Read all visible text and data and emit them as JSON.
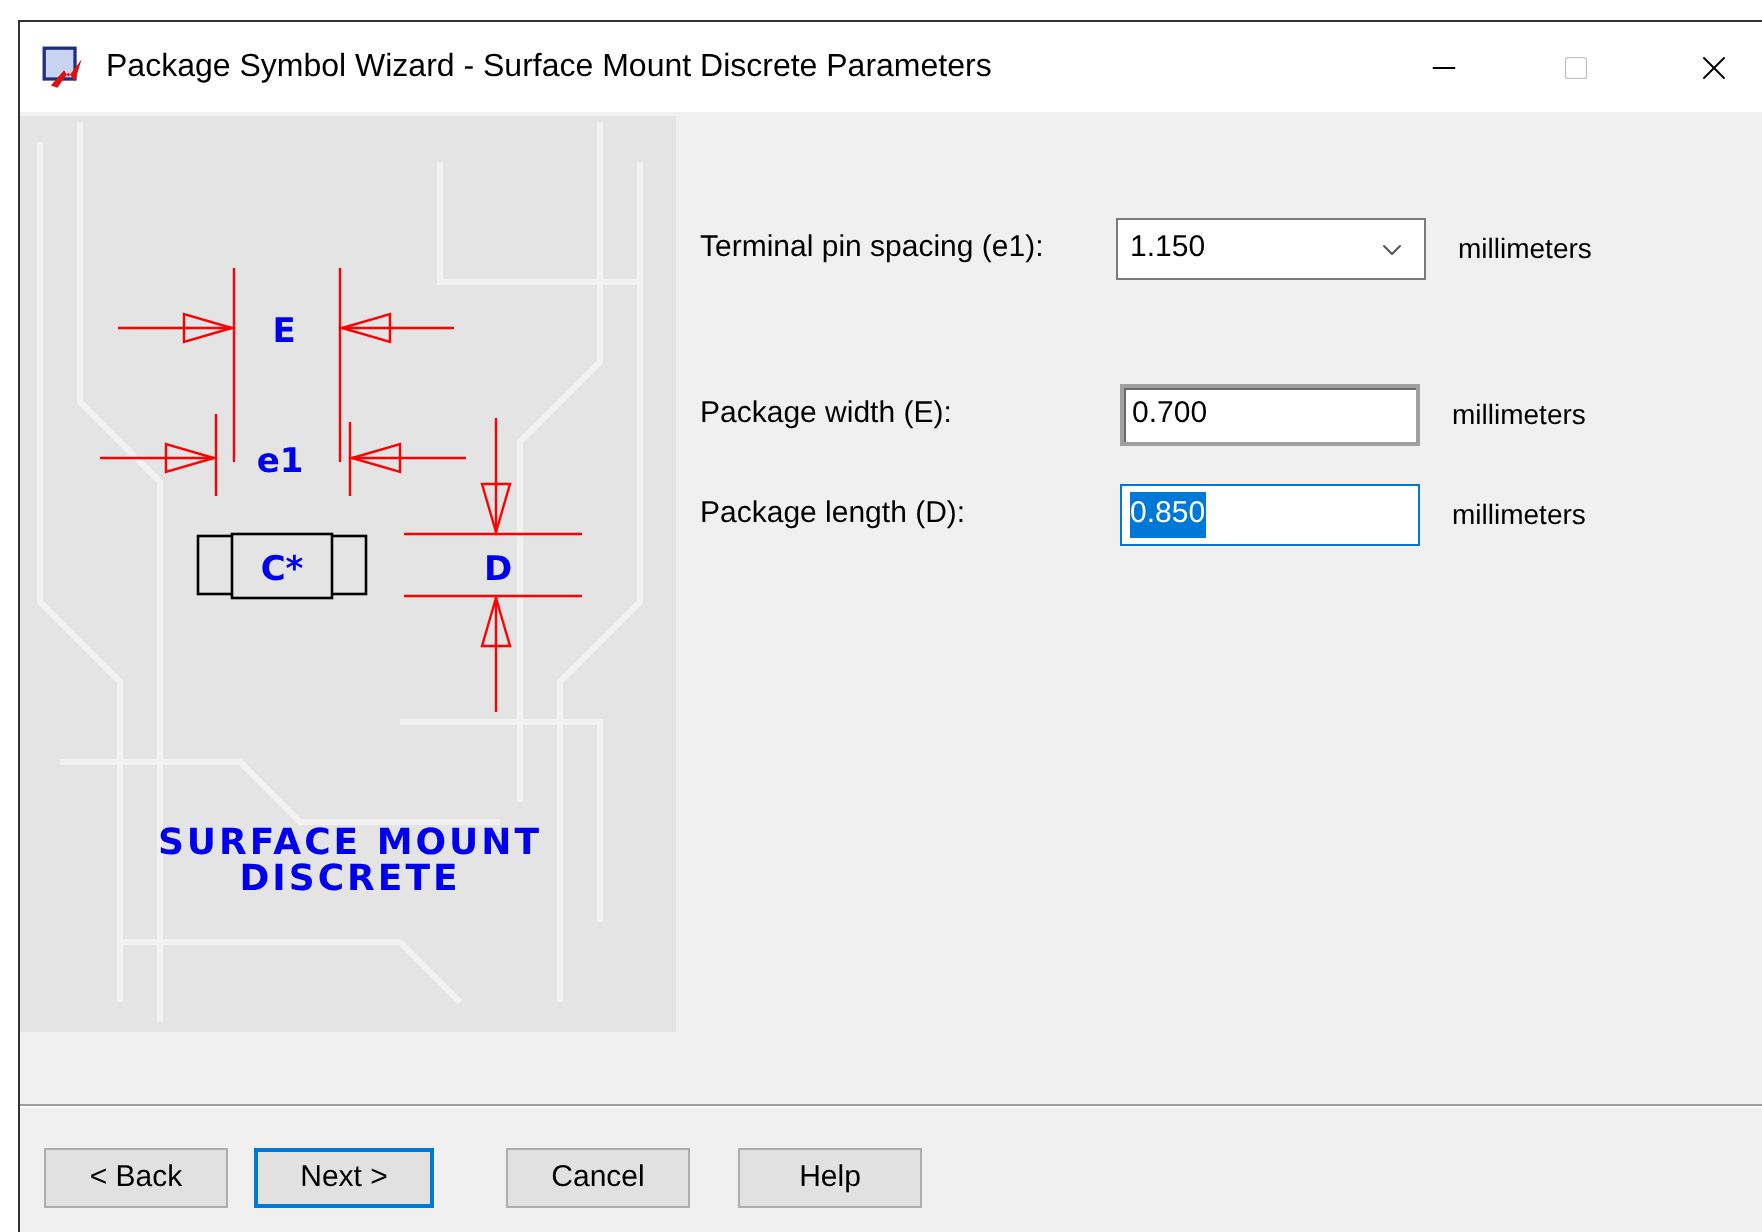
{
  "window": {
    "title": "Package Symbol Wizard - Surface Mount Discrete Parameters"
  },
  "illustration": {
    "width_label": "E",
    "pitch_label": "e1",
    "body_label": "C*",
    "length_label": "D",
    "caption": [
      "SURFACE MOUNT",
      "DISCRETE"
    ]
  },
  "fields": [
    {
      "kind": "dropdown",
      "label": "Terminal pin spacing (e1):",
      "value": "1.150",
      "unit": "millimeters",
      "focused": false
    },
    {
      "kind": "text",
      "label": "Package width (E):",
      "value": "0.700",
      "unit": "millimeters",
      "focused": false
    },
    {
      "kind": "text",
      "label": "Package length (D):",
      "value": "0.850",
      "unit": "millimeters",
      "focused": true
    }
  ],
  "buttons": [
    {
      "label": "< Back",
      "default": false
    },
    {
      "label": "Next >",
      "default": true
    },
    {
      "label": "Cancel",
      "default": false
    },
    {
      "label": "Help",
      "default": false
    }
  ]
}
